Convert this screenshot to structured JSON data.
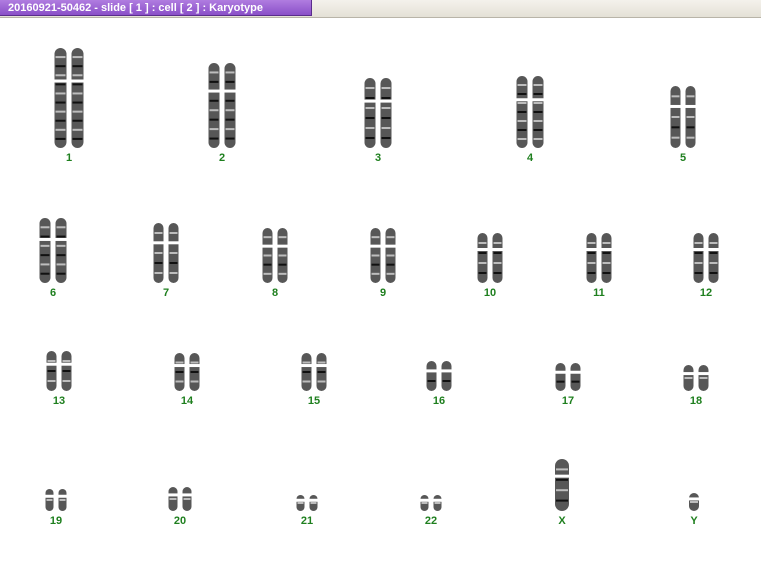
{
  "window": {
    "title": "20160921-50462 - slide [ 1 ] : cell [ 2 ] : Karyotype"
  },
  "karyotype": {
    "chromosomes": [
      {
        "label": "1"
      },
      {
        "label": "2"
      },
      {
        "label": "3"
      },
      {
        "label": "4"
      },
      {
        "label": "5"
      },
      {
        "label": "6"
      },
      {
        "label": "7"
      },
      {
        "label": "8"
      },
      {
        "label": "9"
      },
      {
        "label": "10"
      },
      {
        "label": "11"
      },
      {
        "label": "12"
      },
      {
        "label": "13"
      },
      {
        "label": "14"
      },
      {
        "label": "15"
      },
      {
        "label": "16"
      },
      {
        "label": "17"
      },
      {
        "label": "18"
      },
      {
        "label": "19"
      },
      {
        "label": "20"
      },
      {
        "label": "21"
      },
      {
        "label": "22"
      },
      {
        "label": "X"
      },
      {
        "label": "Y"
      }
    ],
    "colors": {
      "label": "#1e7f1e",
      "chromosome": "#3a3a3a",
      "tab": "#9a62d4"
    }
  }
}
